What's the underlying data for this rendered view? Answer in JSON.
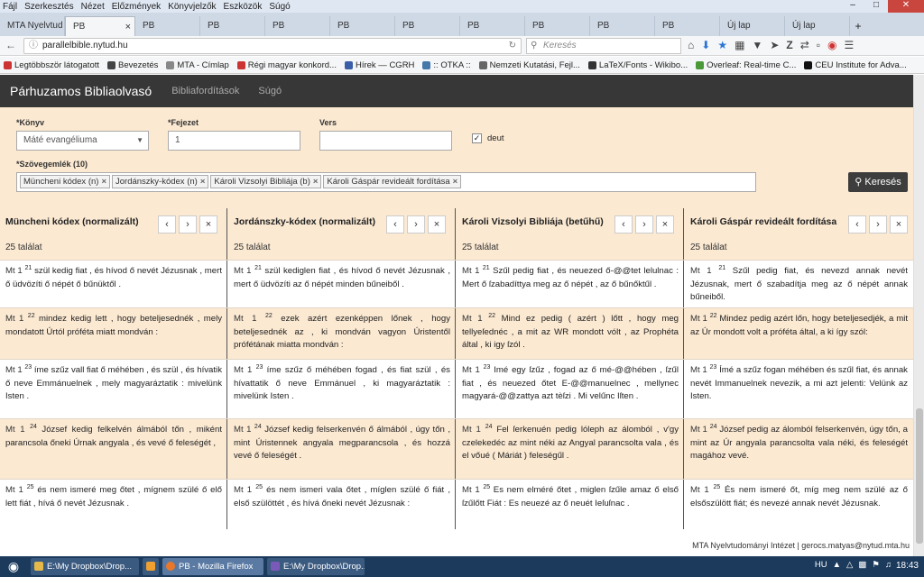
{
  "menu": [
    "Fájl",
    "Szerkesztés",
    "Nézet",
    "Előzmények",
    "Könyvjelzők",
    "Eszközök",
    "Súgó"
  ],
  "tabs": [
    {
      "label": "MTA Nyelvtud",
      "active": false
    },
    {
      "label": "PB",
      "active": true
    },
    {
      "label": "PB"
    },
    {
      "label": "PB"
    },
    {
      "label": "PB"
    },
    {
      "label": "PB"
    },
    {
      "label": "PB"
    },
    {
      "label": "PB"
    },
    {
      "label": "PB"
    },
    {
      "label": "PB"
    },
    {
      "label": "PB"
    },
    {
      "label": "Új lap"
    },
    {
      "label": "Új lap"
    }
  ],
  "url": "parallelbible.nytud.hu",
  "search_placeholder": "Keresés",
  "bookmarks": [
    {
      "label": "Legtöbbször látogatott",
      "color": "#c33"
    },
    {
      "label": "Bevezetés",
      "color": "#444"
    },
    {
      "label": "MTA - Címlap",
      "color": "#888"
    },
    {
      "label": "Régi magyar konkord...",
      "color": "#c33"
    },
    {
      "label": "Hírek — CGRH",
      "color": "#3a5ea8"
    },
    {
      "label": ":: OTKA ::",
      "color": "#4477aa"
    },
    {
      "label": "Nemzeti Kutatási, Fejl...",
      "color": "#666"
    },
    {
      "label": "LaTeX/Fonts - Wikibo...",
      "color": "#333"
    },
    {
      "label": "Overleaf: Real-time C...",
      "color": "#4a9a3a"
    },
    {
      "label": "CEU Institute for Adva...",
      "color": "#111"
    }
  ],
  "app": {
    "brand": "Párhuzamos Bibliaolvasó",
    "links": [
      "Bibliafordítások",
      "Súgó"
    ]
  },
  "form": {
    "book_label": "*Könyv",
    "book_value": "Máté evangéliuma",
    "chapter_label": "*Fejezet",
    "chapter_value": "1",
    "verse_label": "Vers",
    "verse_value": "",
    "deut_label": "deut",
    "texts_label": "*Szövegemlék (10)",
    "chips": [
      "Müncheni kódex (n)",
      "Jordánszky-kódex (n)",
      "Károli Vizsolyi Bibliája (b)",
      "Károli Gáspár revideált fordítása"
    ],
    "search_button": "Keresés"
  },
  "columns": [
    {
      "title": "Müncheni kódex (normalizált)",
      "count": "25 találat",
      "verses": [
        {
          "ref": "Mt 1",
          "num": "21",
          "text": "szül kedig fiat , és hívod ő nevét Jézusnak , mert ő üdvözíti ő népét ő bűnüktől ."
        },
        {
          "ref": "Mt 1",
          "num": "22",
          "text": "mindez kedig lett , hogy beteljesednék , mely mondatott Úrtól próféta miatt mondván :"
        },
        {
          "ref": "Mt 1",
          "num": "23",
          "text": "íme szűz vall fiat ő méhében , és szül , és hívatik ő neve Emmánuelnek , mely magyaráztatik : mivelünk Isten ."
        },
        {
          "ref": "Mt 1",
          "num": "24",
          "text": "József kedig felkelvén álmából tőn , miként parancsola őneki Úrnak angyala , és vevé ő feleségét ,"
        },
        {
          "ref": "Mt 1",
          "num": "25",
          "text": "és nem ismeré meg őtet , mígnem szülé ő elő lett fiát , hívá ő nevét Jézusnak ."
        }
      ]
    },
    {
      "title": "Jordánszky-kódex (normalizált)",
      "count": "25 találat",
      "verses": [
        {
          "ref": "Mt 1",
          "num": "21",
          "text": "szül kediglen fiat , és hívod ő nevét Jézusnak , mert ő üdvözíti az ő népét minden bűneiből ."
        },
        {
          "ref": "Mt 1",
          "num": "22",
          "text": "ezek azért ezenképpen lőnek , hogy beteljesednék az , ki mondván vagyon Úristentől prófétának miatta mondván :"
        },
        {
          "ref": "Mt 1",
          "num": "23",
          "text": "íme szűz ő méhében fogad , és fiat szül , és hívattatik ő neve Emmánuel , ki magyaráztatik : mivelünk Isten ."
        },
        {
          "ref": "Mt 1",
          "num": "24",
          "text": "József kedig felserkenvén ő álmából , úgy tőn , mint Úristennek angyala megparancsola , és hozzá vevé ő feleségét ."
        },
        {
          "ref": "Mt 1",
          "num": "25",
          "text": "és nem ismeri vala őtet , míglen szülé ő fiát , első szülöttét , és hívá őneki nevét Jézusnak :"
        }
      ]
    },
    {
      "title": "Károli Vizsolyi Bibliája (betűhű)",
      "count": "25 találat",
      "verses": [
        {
          "ref": "Mt 1",
          "num": "21",
          "text": "Szűl pedig fiat , és neuezed ő-@@tet lelulnac : Mert ő ſzabadíttya meg az ő népét , az ő bűnőktűl ."
        },
        {
          "ref": "Mt 1",
          "num": "22",
          "text": "Mind ez pedig ( azért ) lőtt , hogy meg tellyeſednéc , a mit az WR mondott vólt , az Prophéta által , ki igy ſzól ."
        },
        {
          "ref": "Mt 1",
          "num": "23",
          "text": "Imé egy ſzűz , fogad az ő mé-@@hében , ſzűl fiat , és neuezed őtet E-@@manuelnec , mellynec magyará-@@zattya azt tèſzi . Mi velűnc Iſten ."
        },
        {
          "ref": "Mt 1",
          "num": "24",
          "text": "Fel ſerkenuén pedig lóleph az álomból , v'gy czelekedéc az mint néki az Angyal parancsolta vala , és el vőué ( Máriát ) feleségűl ."
        },
        {
          "ref": "Mt 1",
          "num": "25",
          "text": "Es nem elméré őtet , miglen ſzűle amaz ő első ſzűlőtt Fiát : Es neuezé az ő neuét Ieſuſnac ."
        }
      ]
    },
    {
      "title": "Károli Gáspár revideált fordítása",
      "count": "25 találat",
      "verses": [
        {
          "ref": "Mt 1",
          "num": "21",
          "text": "Szűl pedig fiat, és nevezd annak nevét Jézusnak, mert ő szabadítja meg az ő népét annak bűneiből."
        },
        {
          "ref": "Mt 1",
          "num": "22",
          "text": "Mindez pedig azért lőn, hogy beteljesedjék, a mit az Úr mondott volt a próféta által, a ki így szól:"
        },
        {
          "ref": "Mt 1",
          "num": "23",
          "text": "Ímé a szűz fogan méhében és szűl fiat, és annak nevét Immanuelnek nevezik, a mi azt jelenti: Velünk az Isten."
        },
        {
          "ref": "Mt 1",
          "num": "24",
          "text": "József pedig az álomból felserkenvén, úgy tőn, a mint az Úr angyala parancsolta vala néki, és feleségét magához vevé."
        },
        {
          "ref": "Mt 1",
          "num": "25",
          "text": "És nem ismeré őt, míg meg nem szülé az ő elsőszülött fiát; és nevezé annak nevét Jézusnak."
        }
      ]
    }
  ],
  "footer": "MTA Nyelvtudományi Intézet | gerocs.matyas@nytud.mta.hu",
  "taskbar": {
    "items": [
      "E:\\My Dropbox\\Drop...",
      "PB - Mozilla Firefox",
      "E:\\My Dropbox\\Drop..."
    ],
    "lang": "HU",
    "clock": "18:43"
  }
}
